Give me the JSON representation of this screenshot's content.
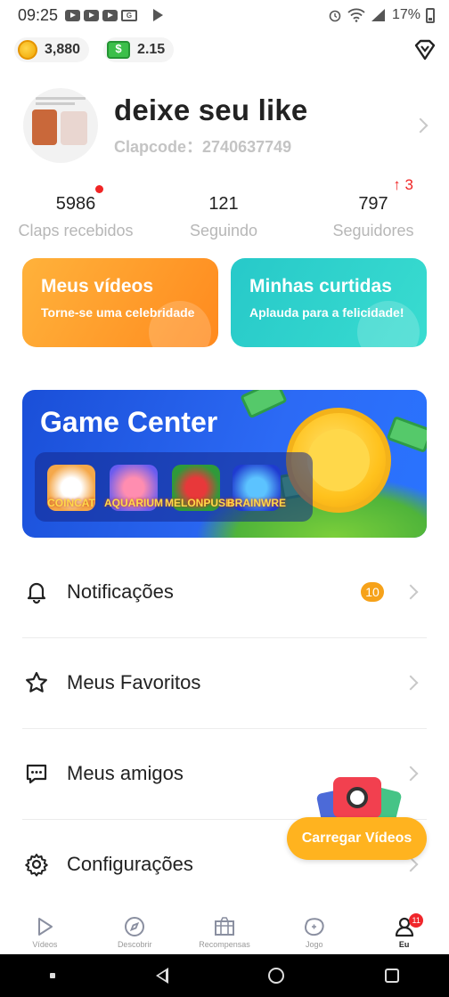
{
  "status_bar": {
    "time": "09:25",
    "battery": "17%"
  },
  "wallet": {
    "coins": "3,880",
    "cash": "2.15"
  },
  "profile": {
    "name": "deixe seu like",
    "clapcode_label": "Clapcode：",
    "clapcode": "2740637749"
  },
  "stats": [
    {
      "value": "5986",
      "label": "Claps recebidos"
    },
    {
      "value": "121",
      "label": "Seguindo"
    },
    {
      "value": "797",
      "label": "Seguidores"
    }
  ],
  "followers_delta": "3",
  "cards": {
    "videos": {
      "title": "Meus vídeos",
      "subtitle": "Torne-se uma celebridade"
    },
    "likes": {
      "title": "Minhas curtidas",
      "subtitle": "Aplauda para a felicidade!"
    }
  },
  "game_center": {
    "title": "Game Center",
    "games": [
      "COINCAT",
      "AQUARIUM",
      "MELONPUSH",
      "BRAINWRE"
    ]
  },
  "menu": [
    {
      "label": "Notificações",
      "icon": "bell-icon",
      "badge": "10"
    },
    {
      "label": "Meus Favoritos",
      "icon": "star-icon"
    },
    {
      "label": "Meus amigos",
      "icon": "chat-icon"
    },
    {
      "label": "Configurações",
      "icon": "gear-icon"
    }
  ],
  "upload_button": "Carregar Vídeos",
  "bottom_nav": [
    {
      "label": "Vídeos",
      "icon": "play-icon"
    },
    {
      "label": "Descobrir",
      "icon": "compass-icon"
    },
    {
      "label": "Recompensas",
      "icon": "gift-icon"
    },
    {
      "label": "Jogo",
      "icon": "game-icon"
    },
    {
      "label": "Eu",
      "icon": "user-icon",
      "badge": "11",
      "active": true
    }
  ],
  "colors": {
    "accent": "#ffb31f",
    "orange_card": "#ff9a2a",
    "teal_card": "#2fd2cc",
    "game_blue": "#2060e8",
    "badge_red": "#f02525"
  }
}
